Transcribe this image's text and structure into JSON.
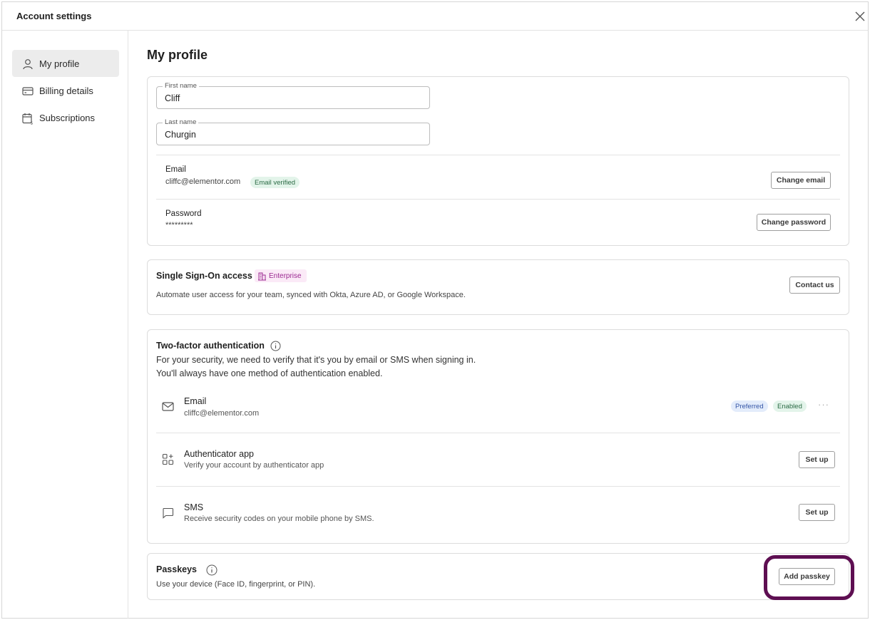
{
  "window": {
    "title": "Account settings"
  },
  "sidebar": {
    "items": [
      {
        "label": "My profile",
        "icon": "user-icon",
        "active": true
      },
      {
        "label": "Billing details",
        "icon": "credit-card-icon",
        "active": false
      },
      {
        "label": "Subscriptions",
        "icon": "calendar-dollar-icon",
        "active": false
      }
    ]
  },
  "profile": {
    "heading": "My profile",
    "first_name": {
      "label": "First name",
      "value": "Cliff"
    },
    "last_name": {
      "label": "Last name",
      "value": "Churgin"
    },
    "email": {
      "label": "Email",
      "value": "cliffc@elementor.com",
      "badge": "Email verified",
      "button": "Change email"
    },
    "password": {
      "label": "Password",
      "value": "*********",
      "button": "Change password"
    }
  },
  "sso": {
    "title": "Single Sign-On access",
    "badge": "Enterprise",
    "description": "Automate user access for your team, synced with Okta, Azure AD, or Google Workspace.",
    "button": "Contact us"
  },
  "two_factor": {
    "title": "Two-factor authentication",
    "description_line1": "For your security, we need to verify that it's you by email or SMS when signing in.",
    "description_line2": "You'll always have one method of authentication enabled.",
    "methods": [
      {
        "title": "Email",
        "subtitle": "cliffc@elementor.com",
        "badge_preferred": "Preferred",
        "badge_enabled": "Enabled",
        "more": "···"
      },
      {
        "title": "Authenticator app",
        "subtitle": "Verify your account by authenticator app",
        "button": "Set up"
      },
      {
        "title": "SMS",
        "subtitle": "Receive security codes on your mobile phone by SMS.",
        "button": "Set up"
      }
    ]
  },
  "passkeys": {
    "title": "Passkeys",
    "description": "Use your device (Face ID, fingerprint, or PIN).",
    "button": "Add passkey"
  },
  "colors": {
    "highlight": "#5e0f52",
    "enterprise": "#9b2891",
    "verified_bg": "#e3f4ea",
    "preferred_bg": "#e3ecfb"
  }
}
